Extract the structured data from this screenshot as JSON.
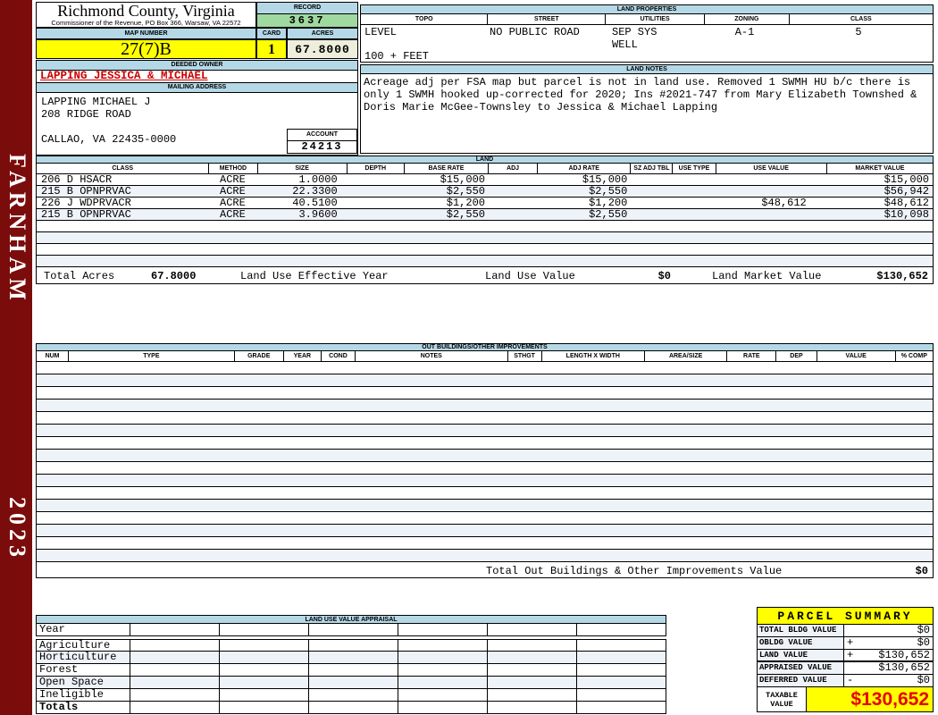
{
  "colors": {
    "spine_maroon": "#7b0c0c",
    "header_blue": "#b5d8e6",
    "record_green": "#a0d9a0",
    "highlight_yellow": "#ffff00",
    "acres_cream": "#eeeedd",
    "row_stripe": "#eef2f9",
    "owner_red": "#cc0000",
    "taxable_red": "#e60000"
  },
  "spine": {
    "district": "FARNHAM",
    "year": "2023"
  },
  "header": {
    "county_title": "Richmond County, Virginia",
    "county_subtitle": "Commissioner of the Revenue, PO Box 366, Warsaw, VA 22572",
    "record_label": "RECORD",
    "record_value": "3637",
    "map_label": "MAP NUMBER",
    "map_value": "27(7)B",
    "card_label": "CARD",
    "card_value": "1",
    "acres_label": "ACRES",
    "acres_value": "67.8000"
  },
  "land_properties": {
    "title": "LAND PROPERTIES",
    "columns": [
      "TOPO",
      "STREET",
      "UTILITIES",
      "ZONING",
      "CLASS"
    ],
    "topo": "LEVEL",
    "topo_line2": "100 + FEET",
    "street": "NO PUBLIC ROAD",
    "utilities_line1": "SEP SYS",
    "utilities_line2": "WELL",
    "zoning": "A-1",
    "class": "5"
  },
  "owner": {
    "deeded_label": "DEEDED OWNER",
    "name": "LAPPING JESSICA & MICHAEL",
    "mailing_label": "MAILING ADDRESS",
    "address_line1": "LAPPING MICHAEL J",
    "address_line2": "208 RIDGE ROAD",
    "address_line3": "CALLAO, VA 22435-0000",
    "account_label": "ACCOUNT",
    "account_value": "24213"
  },
  "land_notes": {
    "title": "LAND NOTES",
    "text": "Acreage adj per FSA map but parcel is not in land use. Removed 1 SWMH HU b/c there is only 1 SWMH hooked up-corrected for 2020; Ins #2021-747 from Mary Elizabeth Townshed & Doris Marie McGee-Townsley to Jessica & Michael Lapping"
  },
  "land": {
    "title": "LAND",
    "columns": [
      "CLASS",
      "METHOD",
      "SIZE",
      "DEPTH",
      "BASE RATE",
      "ADJ",
      "ADJ RATE",
      "SZ ADJ TBL",
      "USE TYPE",
      "USE VALUE",
      "MARKET VALUE"
    ],
    "rows": [
      [
        "206 D HSACR",
        "ACRE",
        "1.0000",
        "",
        "$15,000",
        "",
        "$15,000",
        "",
        "",
        "",
        "$15,000"
      ],
      [
        "215 B OPNPRVAC",
        "ACRE",
        "22.3300",
        "",
        "$2,550",
        "",
        "$2,550",
        "",
        "",
        "",
        "$56,942"
      ],
      [
        "226 J WDPRVACR",
        "ACRE",
        "40.5100",
        "",
        "$1,200",
        "",
        "$1,200",
        "",
        "",
        "$48,612",
        "$48,612"
      ],
      [
        "215 B OPNPRVAC",
        "ACRE",
        "3.9600",
        "",
        "$2,550",
        "",
        "$2,550",
        "",
        "",
        "",
        "$10,098"
      ]
    ],
    "empty_row_count": 4,
    "totals": {
      "acres_label": "Total Acres",
      "acres_value": "67.8000",
      "effective_label": "Land Use Effective Year",
      "use_label": "Land Use Value",
      "use_value": "$0",
      "market_label": "Land Market Value",
      "market_value": "$130,652"
    }
  },
  "out_buildings": {
    "title": "OUT BUILDINGS/OTHER IMPROVEMENTS",
    "columns": [
      "NUM",
      "TYPE",
      "GRADE",
      "YEAR",
      "COND",
      "NOTES",
      "STHGT",
      "LENGTH X WIDTH",
      "AREA/SIZE",
      "RATE",
      "DEP",
      "VALUE",
      "% COMP"
    ],
    "empty_row_count": 16,
    "total_label": "Total Out Buildings & Other Improvements Value",
    "total_value": "$0"
  },
  "land_use_appraisal": {
    "title": "LAND USE VALUE APPRAISAL",
    "row_labels": [
      "Year",
      "Agriculture",
      "Horticulture",
      "Forest",
      "Open Space",
      "Ineligible",
      "Totals"
    ]
  },
  "parcel_summary": {
    "title": "PARCEL SUMMARY",
    "rows": [
      {
        "label": "TOTAL BLDG VALUE",
        "op": "",
        "value": "$0"
      },
      {
        "label": "OBLDG VALUE",
        "op": "+",
        "value": "$0"
      },
      {
        "label": "LAND VALUE",
        "op": "+",
        "value": "$130,652"
      },
      {
        "label": "APPRAISED VALUE",
        "op": "",
        "value": "$130,652"
      },
      {
        "label": "DEFERRED VALUE",
        "op": "-",
        "value": "$0"
      }
    ],
    "taxable_label_line1": "TAXABLE",
    "taxable_label_line2": "VALUE",
    "taxable_value": "$130,652"
  }
}
